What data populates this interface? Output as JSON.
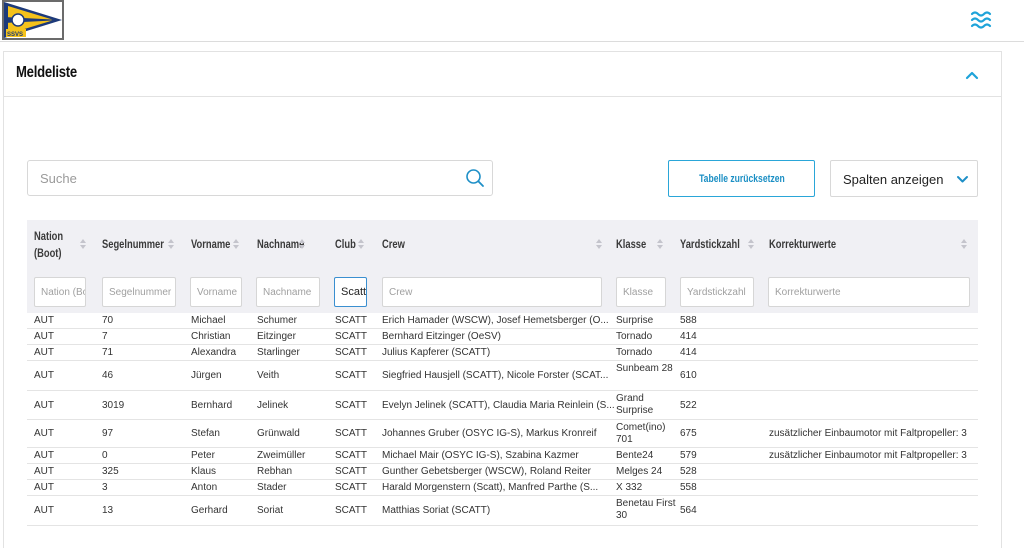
{
  "logo": {
    "text": "SSVS",
    "colors": {
      "yellow": "#f4c21b",
      "navy": "#1d3a7a"
    }
  },
  "header": {
    "menu_icon": "waves-menu-icon",
    "accent": "#1ea3d9"
  },
  "section": {
    "title": "Meldeliste"
  },
  "controls": {
    "search_placeholder": "Suche",
    "reset_label": "Tabelle zurücksetzen",
    "columns_label": "Spalten anzeigen"
  },
  "columns": [
    {
      "label": "Nation (Boot)",
      "filter_placeholder": "Nation (Boo",
      "filter_value": ""
    },
    {
      "label": "Segelnummer",
      "filter_placeholder": "Segelnummer",
      "filter_value": ""
    },
    {
      "label": "Vorname",
      "filter_placeholder": "Vorname",
      "filter_value": ""
    },
    {
      "label": "Nachname",
      "filter_placeholder": "Nachname",
      "filter_value": ""
    },
    {
      "label": "Club",
      "filter_placeholder": "Club",
      "filter_value": "Scatt"
    },
    {
      "label": "Crew",
      "filter_placeholder": "Crew",
      "filter_value": ""
    },
    {
      "label": "Klasse",
      "filter_placeholder": "Klasse",
      "filter_value": ""
    },
    {
      "label": "Yardstickzahl",
      "filter_placeholder": "Yardstickzahl",
      "filter_value": ""
    },
    {
      "label": "Korrekturwerte",
      "filter_placeholder": "Korrekturwerte",
      "filter_value": ""
    }
  ],
  "rows": [
    {
      "nation": "AUT",
      "segel": "70",
      "vorname": "Michael",
      "nachname": "Schumer",
      "club": "SCATT",
      "crew": "Erich Hamader (WSCW), Josef Hemetsberger (O...",
      "klasse": "Surprise",
      "yard": "588",
      "korr": ""
    },
    {
      "nation": "AUT",
      "segel": "7",
      "vorname": "Christian",
      "nachname": "Eitzinger",
      "club": "SCATT",
      "crew": "Bernhard Eitzinger (OeSV)",
      "klasse": "Tornado",
      "yard": "414",
      "korr": ""
    },
    {
      "nation": "AUT",
      "segel": "71",
      "vorname": "Alexandra",
      "nachname": "Starlinger",
      "club": "SCATT",
      "crew": "Julius Kapferer (SCATT)",
      "klasse": "Tornado",
      "yard": "414",
      "korr": ""
    },
    {
      "nation": "AUT",
      "segel": "46",
      "vorname": "Jürgen",
      "nachname": "Veith",
      "club": "SCATT",
      "crew": "Siegfried Hausjell (SCATT), Nicole Forster (SCAT...",
      "klasse": "Sunbeam 28",
      "yard": "610",
      "korr": ""
    },
    {
      "nation": "AUT",
      "segel": "3019",
      "vorname": "Bernhard",
      "nachname": "Jelinek",
      "club": "SCATT",
      "crew": "Evelyn Jelinek (SCATT), Claudia Maria Reinlein (S...",
      "klasse": "Grand Surprise",
      "yard": "522",
      "korr": ""
    },
    {
      "nation": "AUT",
      "segel": "97",
      "vorname": "Stefan",
      "nachname": "Grünwald",
      "club": "SCATT",
      "crew": "Johannes Gruber (OSYC IG-S), Markus Kronreif",
      "klasse": "Comet(ino) 701",
      "yard": "675",
      "korr": "zusätzlicher Einbaumotor mit Faltpropeller: 3"
    },
    {
      "nation": "AUT",
      "segel": "0",
      "vorname": "Peter",
      "nachname": "Zweimüller",
      "club": "SCATT",
      "crew": "Michael Mair (OSYC IG-S), Szabina Kazmer",
      "klasse": "Bente24",
      "yard": "579",
      "korr": "zusätzlicher Einbaumotor mit Faltpropeller: 3"
    },
    {
      "nation": "AUT",
      "segel": "325",
      "vorname": "Klaus",
      "nachname": "Rebhan",
      "club": "SCATT",
      "crew": "Gunther Gebetsberger (WSCW), Roland Reiter",
      "klasse": "Melges 24",
      "yard": "528",
      "korr": ""
    },
    {
      "nation": "AUT",
      "segel": "3",
      "vorname": "Anton",
      "nachname": "Stader",
      "club": "SCATT",
      "crew": "Harald Morgenstern (Scatt), Manfred Parthe (S...",
      "klasse": "X 332",
      "yard": "558",
      "korr": ""
    },
    {
      "nation": "AUT",
      "segel": "13",
      "vorname": "Gerhard",
      "nachname": "Soriat",
      "club": "SCATT",
      "crew": "Matthias Soriat (SCATT)",
      "klasse": "Benetau First 30",
      "yard": "564",
      "korr": ""
    }
  ]
}
